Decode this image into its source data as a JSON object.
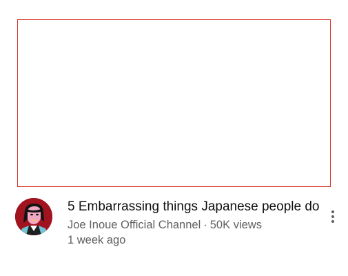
{
  "video": {
    "title": "5 Embarrassing things Japanese people do",
    "channel": "Joe Inoue Official Channel",
    "separator": "·",
    "views": "50K views",
    "age": "1 week ago",
    "avatar_icon": "channel-avatar",
    "menu_icon": "more-vertical-icon"
  },
  "colors": {
    "thumbnail_border": "#d93025",
    "title_text": "#0f0f0f",
    "meta_text": "#606060",
    "avatar_bg": "#a0131f"
  }
}
